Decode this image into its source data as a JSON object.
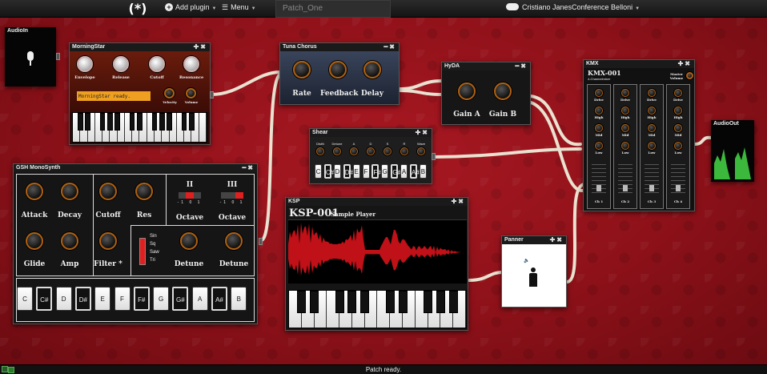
{
  "topbar": {
    "logo": "(*)",
    "add_plugin": "Add plugin",
    "menu": "Menu",
    "patch_name": "Patch_One",
    "user": "Cristiano JanesConference Belloni"
  },
  "status": {
    "text": "Patch ready."
  },
  "audioin": {
    "title": "AudioIn"
  },
  "audioout": {
    "title": "AudioOut"
  },
  "morningstar": {
    "title": "MorningStar",
    "knobs": [
      "Envelope",
      "Release",
      "Cutoff",
      "Resonance"
    ],
    "display": "MorningStar ready.",
    "small_knobs": [
      "Velocity",
      "Volume"
    ]
  },
  "tuna": {
    "title": "Tuna Chorus",
    "knobs": [
      "Rate",
      "Feedback",
      "Delay"
    ]
  },
  "hyda": {
    "title": "HyDA",
    "knobs": [
      "Gain A",
      "Gain B"
    ]
  },
  "shear": {
    "title": "Shear",
    "labels": [
      "DistN",
      "Detune",
      "A",
      "D",
      "S",
      "R",
      "Wave"
    ],
    "keys": [
      "C",
      "C#",
      "D",
      "D#",
      "E",
      "F",
      "F#",
      "G",
      "G#",
      "A",
      "A#",
      "B"
    ]
  },
  "kmx": {
    "title": "KMX",
    "name": "KMX-001",
    "subtitle": "4-Channelmixer",
    "master": "Master Volume",
    "rows": [
      "Drive",
      "High",
      "Mid",
      "Low"
    ],
    "channels": [
      "Ch 1",
      "Ch 2",
      "Ch 3",
      "Ch 4"
    ]
  },
  "gsh": {
    "title": "GSH MonoSynth",
    "knobs": [
      "Attack",
      "Decay",
      "Glide",
      "Amp",
      "Cutoff",
      "Res",
      "Filter *"
    ],
    "osc": [
      "II",
      "III"
    ],
    "octave_label": "Octave",
    "octave_vals": [
      "-1",
      "0",
      "1"
    ],
    "waves": [
      "Sin",
      "Sq",
      "Saw",
      "Tri"
    ],
    "detune": "Detune",
    "keys": [
      "C",
      "C#",
      "D",
      "D#",
      "E",
      "F",
      "F#",
      "G",
      "G#",
      "A",
      "A#",
      "B"
    ]
  },
  "ksp": {
    "title": "KSP",
    "name": "KSP-001",
    "subtitle": "Sample Player"
  },
  "panner": {
    "title": "Panner"
  },
  "colors": {
    "accent": "#b06010",
    "wave": "#c01018",
    "meter": "#3cb83c",
    "background": "#8c1018"
  }
}
